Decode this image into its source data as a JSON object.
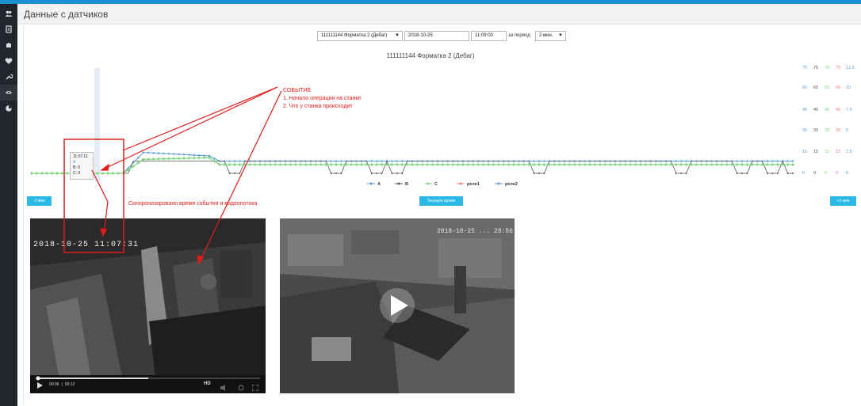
{
  "page": {
    "title": "Данные с датчиков",
    "accent_color": "#1a8fd1"
  },
  "sidebar": {
    "items": [
      {
        "icon": "users-icon"
      },
      {
        "icon": "document-icon"
      },
      {
        "icon": "puzzle-icon"
      },
      {
        "icon": "heart-icon"
      },
      {
        "icon": "wrench-icon"
      },
      {
        "icon": "eye-icon",
        "active": true
      },
      {
        "icon": "pie-chart-icon"
      }
    ]
  },
  "filters": {
    "device_value": "111111144 Форматка 2 (Дебаг)",
    "date_value": "2018-10-25",
    "time_value": "11:09:00",
    "period_label": "за период",
    "period_value": "2 мин."
  },
  "chart_header": {
    "title": "111111144 Форматка 2 (Дебаг)"
  },
  "buttons": {
    "prev_label": "-2 мин",
    "current_label": "Текущее время",
    "next_label": "+2 мин"
  },
  "tooltip": {
    "time": "11:07:11",
    "rows": [
      "A:",
      "B: 0",
      "C: 0"
    ]
  },
  "annotations": {
    "event_title": "СОБЫТИЕ",
    "event_line1": "1. Начало операции на станке",
    "event_line2": "2. Что у станка происходит",
    "sync_note": "Синхронизировано время события и видеопотока"
  },
  "video1": {
    "overlay_time": "2018-10-25  11:07:31",
    "current_time": "00:06",
    "separator": "|",
    "duration": "00:12",
    "hd_label": "HD"
  },
  "video2": {
    "overlay_time": "2018-10-25  ... 28:56"
  },
  "chart_data": {
    "type": "line",
    "title": "111111144 Форматка 2 (Дебаг)",
    "xlabel": "",
    "ylabel": "",
    "legend_position": "bottom",
    "axes": [
      {
        "series": "A",
        "ticks": [
          "75",
          "60",
          "45",
          "30",
          "15",
          "0"
        ],
        "color": "#5b9bd5"
      },
      {
        "series": "B",
        "ticks": [
          "75",
          "60",
          "45",
          "30",
          "15",
          "0"
        ],
        "color": "#555555"
      },
      {
        "series": "C",
        "ticks": [
          "75",
          "60",
          "45",
          "30",
          "15",
          "0"
        ],
        "color": "#7fd67f"
      },
      {
        "series": "реле1",
        "ticks": [
          "75",
          "60",
          "45",
          "30",
          "15",
          "0"
        ],
        "color": "#f08080"
      },
      {
        "series": "реле2",
        "ticks": [
          "12.5",
          "10",
          "7.5",
          "5",
          "2.5",
          "0"
        ],
        "color": "#5b9bd5"
      }
    ],
    "ylim": [
      0,
      75
    ],
    "series": [
      {
        "name": "A",
        "color": "#5b9bd5",
        "segments": [
          [
            0,
            0
          ],
          [
            18,
            0
          ],
          [
            22,
            12
          ],
          [
            35,
            10
          ],
          [
            37,
            7
          ],
          [
            150,
            7
          ]
        ]
      },
      {
        "name": "B",
        "color": "#555555",
        "dips": [
          40,
          60,
          68,
          72,
          100,
          128,
          140,
          146,
          150
        ],
        "base": 7
      },
      {
        "name": "C",
        "color": "#7fd67f",
        "segments": [
          [
            0,
            0
          ],
          [
            18,
            0
          ],
          [
            22,
            8
          ],
          [
            35,
            9
          ],
          [
            37,
            5
          ],
          [
            150,
            5
          ]
        ]
      },
      {
        "name": "реле1",
        "color": "#f08080",
        "values": [
          0
        ]
      },
      {
        "name": "реле2",
        "color": "#5b9bd5",
        "values": [
          0
        ]
      }
    ]
  }
}
